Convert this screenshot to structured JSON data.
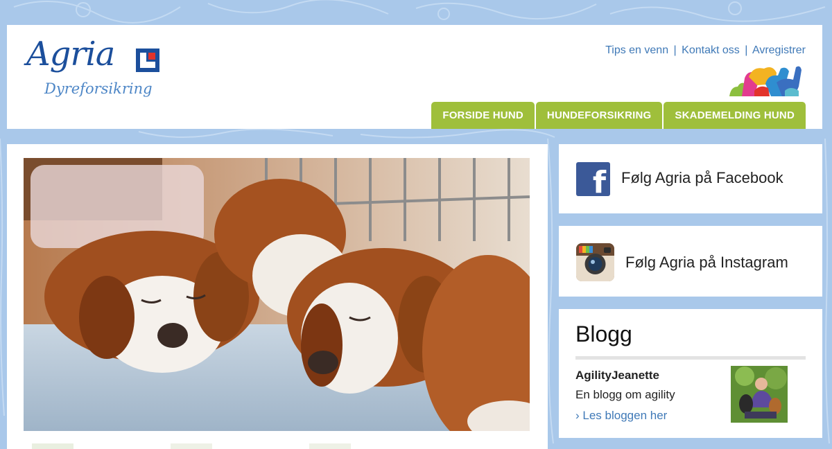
{
  "brand": {
    "name": "Agria",
    "tagline": "Dyreforsikring",
    "color": "#1c4f9c",
    "accent": "#9fbf3b"
  },
  "top_links": [
    "Tips en venn",
    "Kontakt oss",
    "Avregistrer"
  ],
  "nav_tabs": [
    "FORSIDE HUND",
    "HUNDEFORSIKRING",
    "SKADEMELDING HUND"
  ],
  "sidebar": {
    "facebook": {
      "label": "Følg Agria på Facebook",
      "icon": "facebook-icon"
    },
    "instagram": {
      "label": "Følg Agria på Instagram",
      "icon": "instagram-icon"
    },
    "blog": {
      "title": "Blogg",
      "author": "AgilityJeanette",
      "description": "En blogg om agility",
      "link_label": "› Les bloggen her"
    }
  },
  "hero": {
    "subject": "sleeping puppies"
  }
}
